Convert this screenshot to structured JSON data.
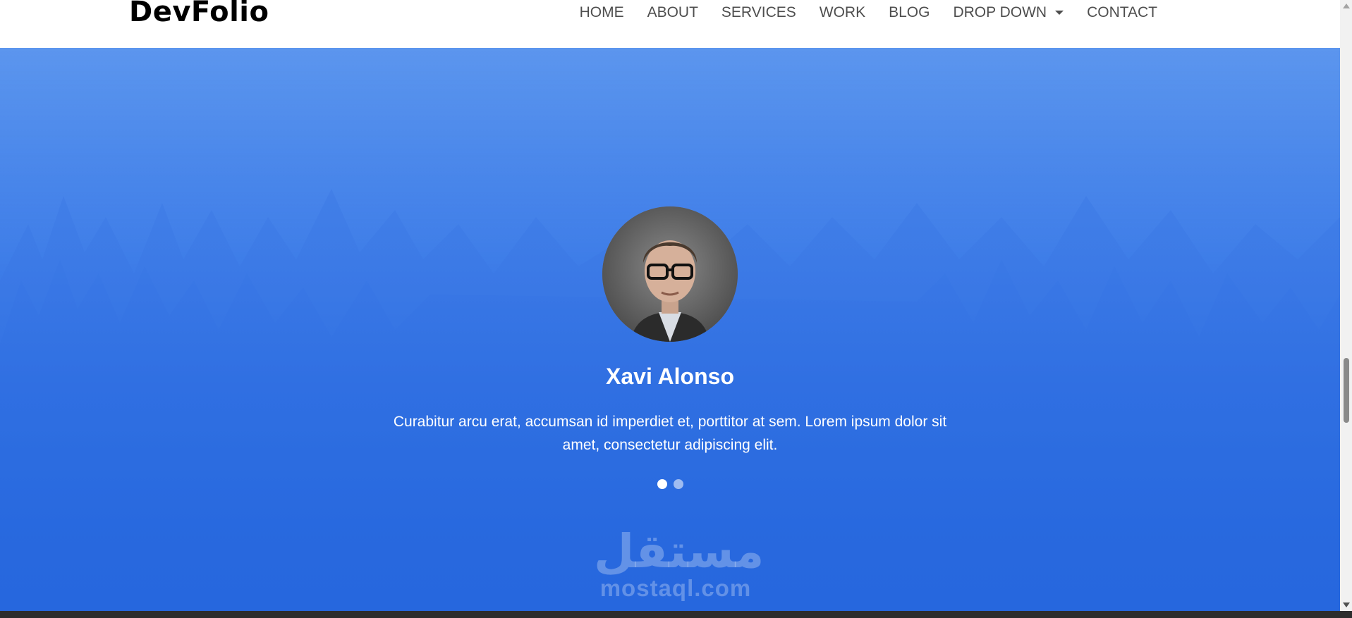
{
  "header": {
    "brand": "DevFolio",
    "nav": [
      {
        "label": "HOME"
      },
      {
        "label": "ABOUT"
      },
      {
        "label": "SERVICES"
      },
      {
        "label": "WORK"
      },
      {
        "label": "BLOG"
      },
      {
        "label": "DROP DOWN",
        "has_caret": true
      },
      {
        "label": "CONTACT"
      }
    ]
  },
  "testimonial": {
    "name": "Xavi Alonso",
    "quote": "Curabitur arcu erat, accumsan id imperdiet et, porttitor at sem. Lorem ipsum dolor sit amet, consectetur adipiscing elit.",
    "slides": 2,
    "active_slide": 1
  },
  "watermark": {
    "arabic": "مستقل",
    "latin": "mostaql.com"
  },
  "colors": {
    "hero_top": "#5c96ee",
    "hero_bottom": "#2366e0",
    "nav_text": "#4e4e4e"
  },
  "icons": {
    "dropdown": "caret-down-icon"
  }
}
